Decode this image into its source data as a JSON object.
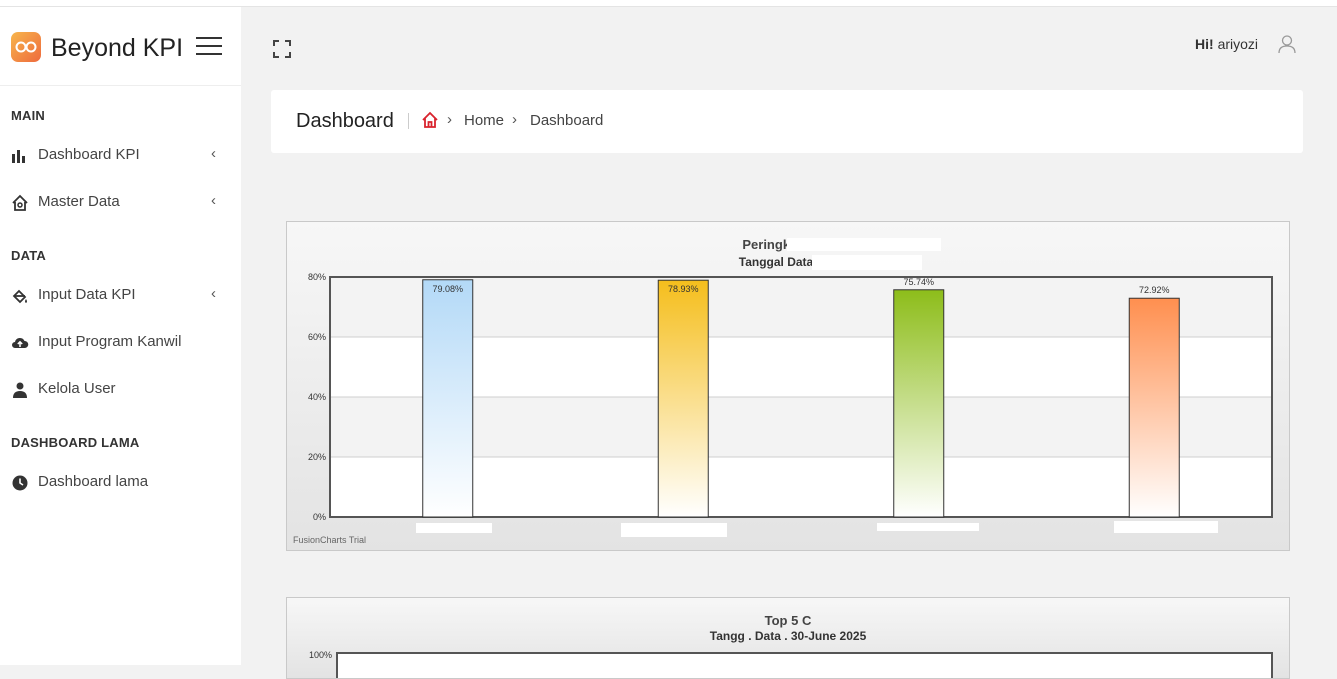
{
  "brand": {
    "name": "Beyond KPI"
  },
  "sidebar": {
    "sections": [
      {
        "title": "MAIN"
      },
      {
        "title": "DATA"
      },
      {
        "title": "DASHBOARD LAMA"
      }
    ],
    "items": [
      {
        "label": "Dashboard KPI",
        "icon": "bar-chart-icon"
      },
      {
        "label": "Master Data",
        "icon": "home-gear-icon"
      },
      {
        "label": "Input Data KPI",
        "icon": "paint-bucket-icon"
      },
      {
        "label": "Input Program Kanwil",
        "icon": "cloud-upload-icon"
      },
      {
        "label": "Kelola User",
        "icon": "user-icon"
      },
      {
        "label": "Dashboard lama",
        "icon": "clock-icon"
      }
    ]
  },
  "header": {
    "greeting": "Hi!",
    "username": "ariyozi"
  },
  "page": {
    "title": "Dashboard",
    "breadcrumb": [
      "Home",
      "Dashboard"
    ]
  },
  "chart1_text": {
    "title": "Peringkat Area",
    "subtitle": "Tanggal Data : 30",
    "watermark": "FusionCharts Trial"
  },
  "chart2_text": {
    "title": "Top 5 C",
    "subtitle": "Tangg . Data . 30-June 2025"
  },
  "chart_data": [
    {
      "type": "bar",
      "title": "Peringkat Area",
      "subtitle": "Tanggal Data : 30",
      "categories": [
        "",
        "",
        "",
        ""
      ],
      "values": [
        79.08,
        78.93,
        75.74,
        72.92
      ],
      "value_labels": [
        "79.08%",
        "78.93%",
        "75.74%",
        "72.92%"
      ],
      "colors": [
        "#b3d9f7",
        "#f5be1c",
        "#8dbd1a",
        "#ff8f4f"
      ],
      "ylim": [
        0,
        80
      ],
      "yticks": [
        "0%",
        "20%",
        "40%",
        "60%",
        "80%"
      ],
      "grid": true
    },
    {
      "type": "bar",
      "title": "Top 5 C",
      "subtitle": "Tangg . Data . 30-June 2025",
      "ylim": [
        0,
        100
      ],
      "yticks": [
        "100%"
      ]
    }
  ],
  "colors": {
    "accent": "#ee6a3d",
    "home_icon": "#d9232d"
  }
}
